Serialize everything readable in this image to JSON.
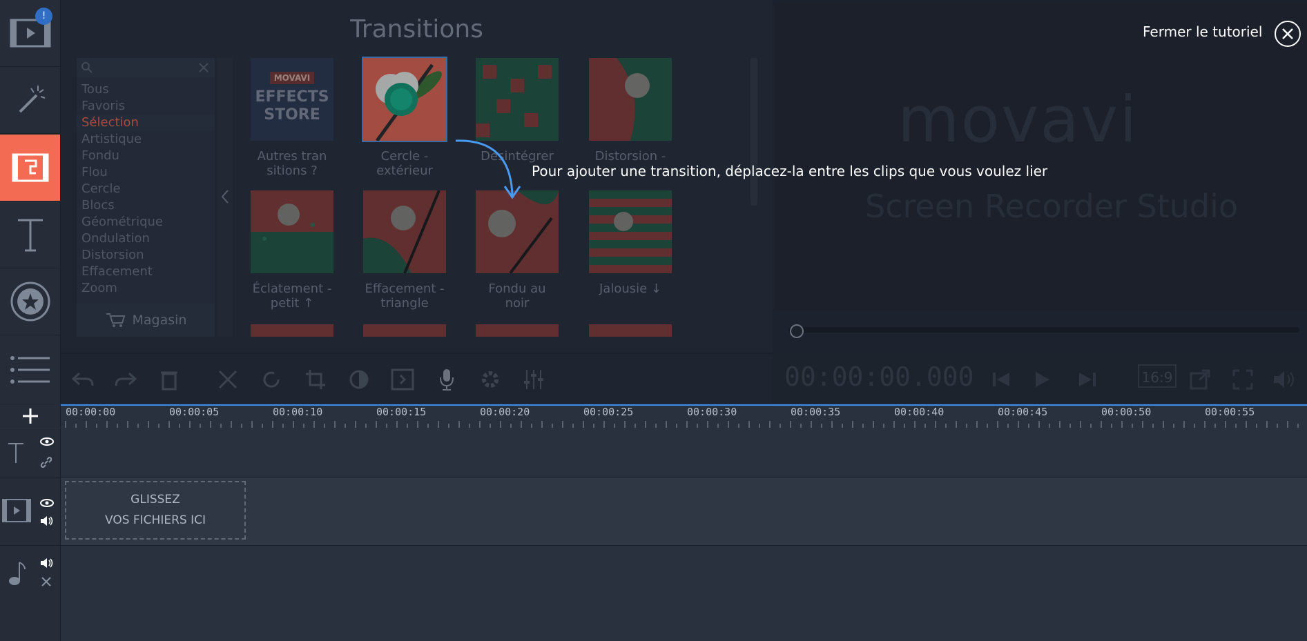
{
  "rail": {
    "badge": "!",
    "items": [
      "import",
      "filters",
      "transitions",
      "titles",
      "stickers",
      "more"
    ]
  },
  "panel": {
    "title": "Transitions",
    "categories": [
      "Tous",
      "Favoris",
      "Sélection",
      "Artistique",
      "Fondu",
      "Flou",
      "Cercle",
      "Blocs",
      "Géométrique",
      "Ondulation",
      "Distorsion",
      "Effacement",
      "Zoom"
    ],
    "selected_category": "Sélection",
    "shop_label": "Magasin",
    "store": {
      "top": "MOVAVI",
      "line1": "EFFECTS",
      "line2": "STORE"
    },
    "thumbnails": [
      {
        "label1": "Autres tran",
        "label2": "sitions ?"
      },
      {
        "label1": "Cercle -",
        "label2": "extérieur"
      },
      {
        "label1": "Désintégrer",
        "label2": ""
      },
      {
        "label1": "Distorsion -",
        "label2": ""
      },
      {
        "label1": "Éclatement -",
        "label2": "petit ↑"
      },
      {
        "label1": "Effacement -",
        "label2": "triangle"
      },
      {
        "label1": "Fondu au",
        "label2": "noir"
      },
      {
        "label1": "Jalousie ↓",
        "label2": ""
      }
    ]
  },
  "tutorial": {
    "tip": "Pour ajouter une transition, déplacez-la entre les clips que vous voulez lier",
    "close_label": "Fermer le tutoriel"
  },
  "preview": {
    "logo": "movavi",
    "product": "Screen Recorder Studio"
  },
  "controls": {
    "timecode": "00:00:00.000",
    "aspect": "16:9"
  },
  "timeline": {
    "ticks": [
      "00:00:00",
      "00:00:05",
      "00:00:10",
      "00:00:15",
      "00:00:20",
      "00:00:25",
      "00:00:30",
      "00:00:35",
      "00:00:40",
      "00:00:45",
      "00:00:50",
      "00:00:55"
    ],
    "drop_line1": "GLISSEZ",
    "drop_line2": "VOS FICHIERS ICI"
  },
  "colors": {
    "accent": "#f26b52",
    "highlight": "#3d8ee8",
    "bg": "#232a36"
  }
}
